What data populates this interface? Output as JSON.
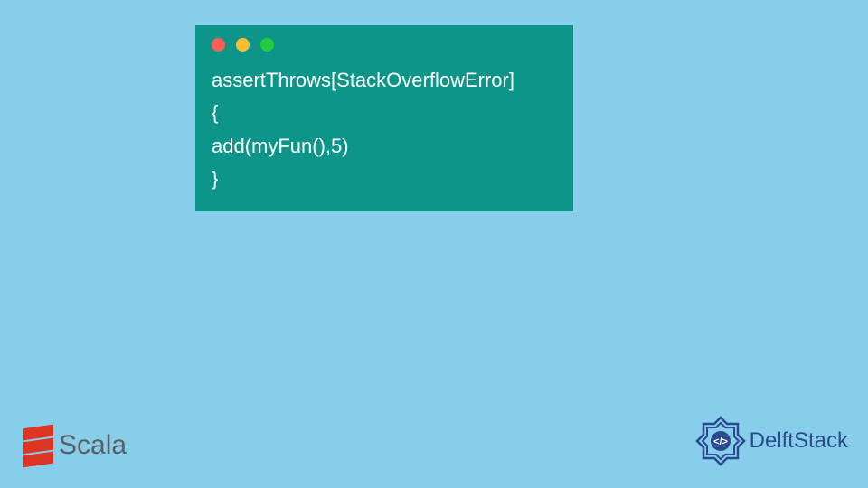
{
  "code": {
    "line1": "assertThrows[StackOverflowError]",
    "line2": "{",
    "line3": "add(myFun(),5)",
    "line4": "}"
  },
  "logos": {
    "scala": "Scala",
    "delftstack": "DelftStack"
  },
  "colors": {
    "background": "#87ceeb",
    "codeWindow": "#0e9589",
    "codeText": "#ffffff",
    "scalaRed": "#de3423",
    "delftBlue": "#2a4b8d"
  }
}
